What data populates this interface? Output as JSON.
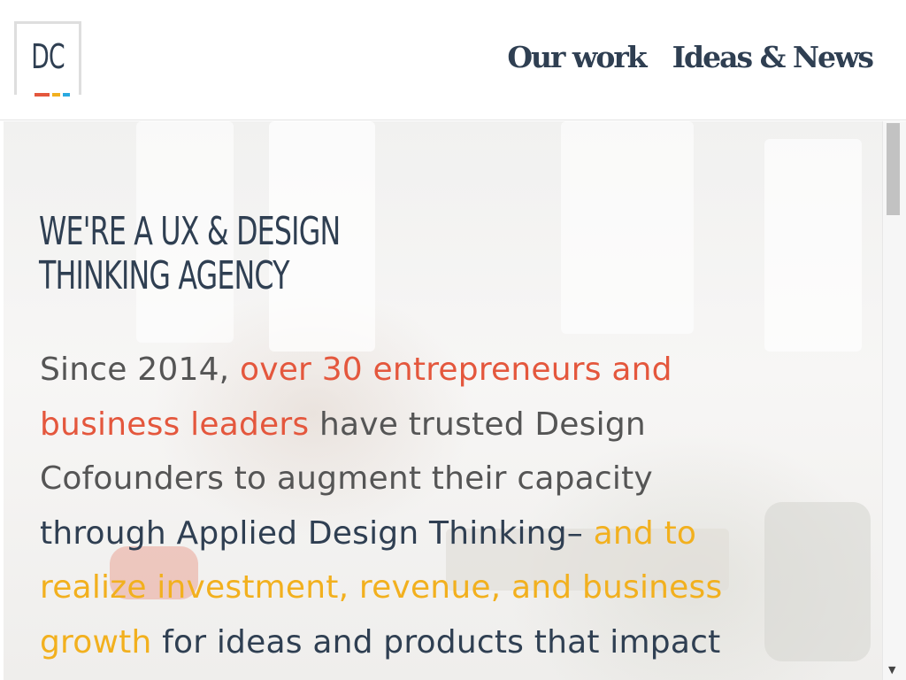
{
  "logo": {
    "text": "DC"
  },
  "nav": {
    "items": [
      "Our work",
      "Ideas & News"
    ]
  },
  "hero": {
    "heading_line1": "WE'RE A UX & DESIGN",
    "heading_line2": "THINKING AGENCY",
    "intro": {
      "part1": "Since 2014, ",
      "part2": "over 30 entrepreneurs and business leaders",
      "part3": " have trusted Design Cofounders to augment their capacity ",
      "part4": "through Applied Design Thinking–",
      "part5": " and to realize investment, revenue, and business growth",
      "part6": " for ideas and products that impact"
    }
  },
  "colors": {
    "navy": "#2f3f52",
    "red_accent": "#e4573d",
    "yellow_accent": "#f2b01e",
    "blue_accent": "#2aa9e0"
  },
  "icons": {
    "scroll_down": "chevron-down-icon"
  }
}
